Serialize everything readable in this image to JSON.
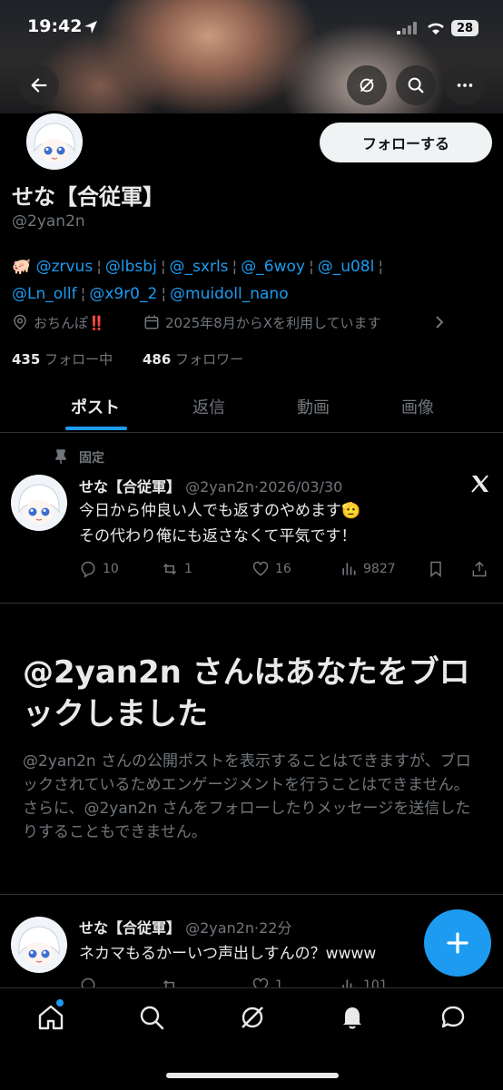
{
  "status_bar": {
    "time": "19:42",
    "battery": "28"
  },
  "profile": {
    "display_name": "せな【合従軍】",
    "handle": "@2yan2n",
    "follow_label": "フォローする",
    "bio_links": [
      "@zrvus",
      "@lbsbj",
      "@_sxrls",
      "@_6woy",
      "@_u08l",
      "@Ln_ollf",
      "@x9r0_2",
      "@muidoll_nano"
    ],
    "location": "おちんぽ",
    "location_emoji": "‼️",
    "joined": "2025年8月からXを利用しています",
    "following_count": "435",
    "following_label": "フォロー中",
    "followers_count": "486",
    "followers_label": "フォロワー"
  },
  "tabs": [
    {
      "label": "ポスト"
    },
    {
      "label": "返信"
    },
    {
      "label": "動画"
    },
    {
      "label": "画像"
    }
  ],
  "pinned_post": {
    "pinned_label": "固定",
    "author": "せな【合従軍】",
    "handle": "@2yan2n",
    "dot": "·",
    "date": "2026/03/30",
    "line1": "今日から仲良い人でも返すのやめます🫡",
    "line2": "その代わり俺にも返さなくて平気です！",
    "replies": "10",
    "reposts": "1",
    "likes": "16",
    "views": "9827"
  },
  "block_notice": {
    "title": "@2yan2n さんはあなたをブロックしました",
    "body": "@2yan2n さんの公開ポストを表示することはできますが、ブロックされているためエンゲージメントを行うことはできません。さらに、@2yan2n さんをフォローしたりメッセージを送信したりすることもできません。"
  },
  "second_post": {
    "author": "せな【合従軍】",
    "handle": "@2yan2n",
    "dot": "·",
    "time": "22分",
    "text": "ネカマもるかーいつ声出しすんの？wwww",
    "likes": "1",
    "views": "101"
  },
  "colors": {
    "accent": "#1d9bf0",
    "muted": "#71767b",
    "background": "#000000"
  }
}
